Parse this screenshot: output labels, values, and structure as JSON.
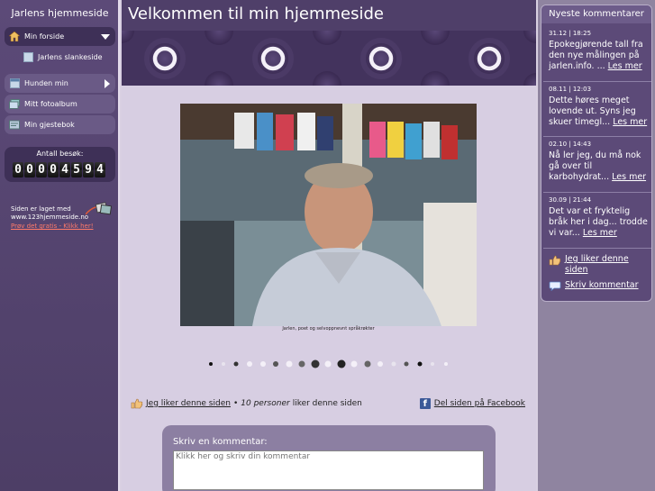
{
  "sidebar": {
    "site_title": "Jarlens hjemmeside",
    "nav": [
      {
        "label": "Min forside",
        "icon": "home-icon"
      },
      {
        "label": "Jarlens slankeside",
        "icon": "page-icon"
      },
      {
        "label": "Hunden min",
        "icon": "page-icon"
      },
      {
        "label": "Mitt fotoalbum",
        "icon": "photo-album-icon"
      },
      {
        "label": "Min gjestebok",
        "icon": "guestbook-icon"
      }
    ],
    "counter_label": "Antall besøk:",
    "counter_digits": [
      "0",
      "0",
      "0",
      "0",
      "4",
      "5",
      "9",
      "4"
    ],
    "made_with_line1": "Siden er laget med",
    "made_with_line2": "www.123hjemmeside.no",
    "made_with_link": "Prøv det gratis - Klikk her!"
  },
  "main": {
    "page_title": "Velkommen til min hjemmeside",
    "photo_caption": "Jarlen, poet og selvoppnevnt språkrøkter",
    "like_link": "Jeg liker denne siden",
    "like_count_prefix": "•",
    "like_count_people": "10 personer",
    "like_count_suffix": "liker denne siden",
    "share_link": "Del siden på Facebook",
    "comment_label": "Skriv en kommentar:",
    "comment_placeholder": "Klikk her og skriv din kommentar"
  },
  "right_panel": {
    "title": "Nyeste kommentarer",
    "comments": [
      {
        "date": "31.12 | 18:25",
        "text": "Epokegjørende tall fra den nye målingen på jarlen.info. ...",
        "more": "Les mer"
      },
      {
        "date": "08.11 | 12:03",
        "text": "Dette høres meget lovende ut. Syns jeg skuer timegl...",
        "more": "Les mer"
      },
      {
        "date": "02.10 | 14:43",
        "text": "Nå ler jeg, du må nok gå over til karbohydrat...",
        "more": "Les mer"
      },
      {
        "date": "30.09 | 21:44",
        "text": "Det var et fryktelig bråk her i dag... trodde vi var...",
        "more": "Les mer"
      }
    ],
    "like_action": "Jeg liker denne siden",
    "comment_action": "Skriv kommentar"
  },
  "colors": {
    "sidebar": "#5c4a78",
    "header": "#4f3f69",
    "main_bg": "#d7cee2",
    "right_bg": "#8f84a0",
    "link_accent": "#ff7a6a",
    "facebook": "#3b5998"
  }
}
